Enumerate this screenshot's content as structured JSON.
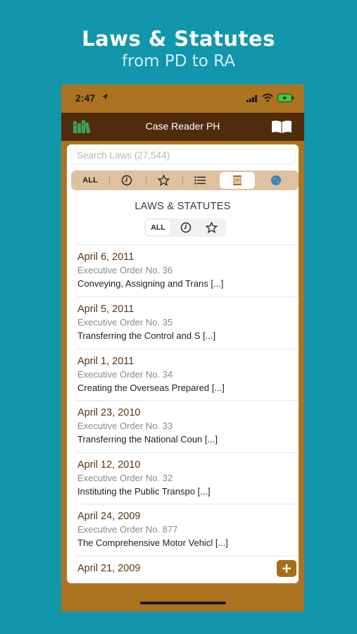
{
  "promo": {
    "headline": "Laws & Statutes",
    "subline": "from PD to RA"
  },
  "status_bar": {
    "time": "2:47",
    "icons": [
      "location-arrow-icon",
      "signal-icon",
      "wifi-icon",
      "battery-charging-icon"
    ]
  },
  "nav": {
    "title": "Case Reader PH",
    "left_icon": "books-icon",
    "right_icon": "open-book-icon"
  },
  "search": {
    "placeholder": "Search Laws (27,544)"
  },
  "filter_tabs": [
    {
      "label": "ALL",
      "icon": null,
      "active": false
    },
    {
      "label": "",
      "icon": "clock-icon",
      "active": false
    },
    {
      "label": "",
      "icon": "star-icon",
      "active": false
    },
    {
      "label": "",
      "icon": "list-icon",
      "active": false
    },
    {
      "label": "",
      "icon": "scroll-icon",
      "active": true
    },
    {
      "label": "",
      "icon": "globe-icon",
      "active": false
    }
  ],
  "section": {
    "title": "LAWS & STATUTES",
    "sub_tabs": [
      {
        "label": "ALL",
        "icon": null,
        "active": true
      },
      {
        "label": "",
        "icon": "clock-icon",
        "active": false
      },
      {
        "label": "",
        "icon": "star-icon",
        "active": false
      }
    ]
  },
  "items": [
    {
      "date": "April 6, 2011",
      "number": "Executive Order No. 36",
      "description": "Conveying, Assigning and Trans [...]"
    },
    {
      "date": "April 5, 2011",
      "number": "Executive Order No. 35",
      "description": "Transferring the Control and S [...]"
    },
    {
      "date": "April 1, 2011",
      "number": "Executive Order No. 34",
      "description": "Creating the Overseas Prepared [...]"
    },
    {
      "date": "April 23, 2010",
      "number": "Executive Order No. 33",
      "description": "Transferring the National Coun [...]"
    },
    {
      "date": "April 12, 2010",
      "number": "Executive Order No. 32",
      "description": "Instituting the Public Transpo [...]"
    },
    {
      "date": "April 24, 2009",
      "number": "Executive Order No. 877",
      "description": "The Comprehensive Motor Vehicl [...]"
    },
    {
      "date": "April 21, 2009",
      "number": "",
      "description": ""
    }
  ],
  "add_button": {
    "label": "+"
  },
  "colors": {
    "background": "#1296ab",
    "accent_brown": "#ac7321",
    "nav_dark": "#4e2c0c",
    "date_text": "#5a3512",
    "books_green": "#3aa55a"
  }
}
